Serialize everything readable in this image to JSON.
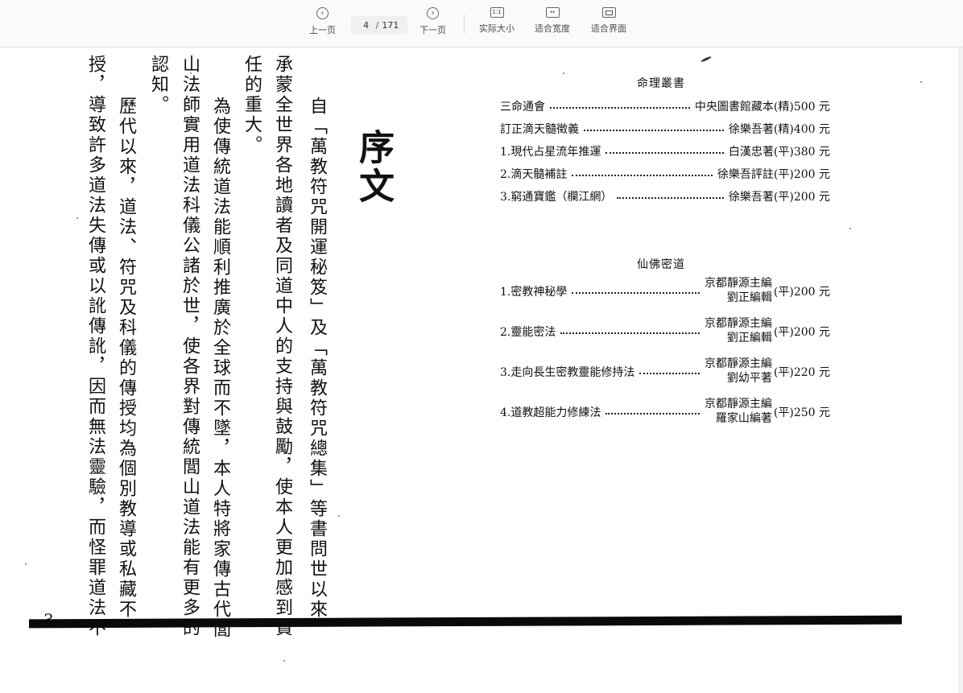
{
  "toolbar": {
    "prev_label": "上一页",
    "current_page": "4",
    "page_separator": "/",
    "total_pages": "171",
    "next_label": "下一页",
    "actual_size_label": "实际大小",
    "fit_width_label": "适合宽度",
    "fit_page_label": "适合界面",
    "actual_size_icon_text": "1:1",
    "fit_width_icon_text": "↔"
  },
  "left_page": {
    "title": "序文",
    "columns": [
      "自「萬教符咒開運秘笈」及「萬教符咒總集」等書問世以來，",
      "承蒙全世界各地讀者及同道中人的支持與鼓勵，使本人更加感到責",
      "任的重大。",
      "為使傳統道法能順利推廣於全球而不墜，本人特將家傳古代閭",
      "山法師實用道法科儀公諸於世，使各界對傳統閭山道法能有更多的",
      "認知。",
      "歷代以來，道法、符咒及科儀的傳授均為個別教導或私藏不",
      "授，導致許多道法失傳或以訛傳訛，因而無法靈驗，而怪罪道法不"
    ],
    "page_number": "3"
  },
  "right_page": {
    "section1_title": "命理叢書",
    "section1_books": [
      {
        "title": "三命通會",
        "author": "中央圖書館藏本(精)",
        "price": "500 元"
      },
      {
        "title": "訂正滴天髓徵義",
        "author": "徐樂吾著(精)",
        "price": "400 元"
      },
      {
        "title": "1.現代占星流年推運",
        "author": "白漢忠著(平)",
        "price": "380 元"
      },
      {
        "title": "2.滴天髓補註",
        "author": "徐樂吾評註(平)",
        "price": "200 元"
      },
      {
        "title": "3.窮通寶鑑（欄江網）",
        "author": "徐樂吾著(平)",
        "price": "200 元"
      }
    ],
    "section2_title": "仙佛密道",
    "section2_books": [
      {
        "title": "1.密教神秘學",
        "author_line1": "京都靜源主編",
        "author_line2": "劉正編輯",
        "binding": "(平)",
        "price": "200 元"
      },
      {
        "title": "2.靈能密法",
        "author_line1": "京都靜源主編",
        "author_line2": "劉正編輯",
        "binding": "(平)",
        "price": "200 元"
      },
      {
        "title": "3.走向長生密教靈能修持法",
        "author_line1": "京都靜源主編",
        "author_line2": "劉幼平著",
        "binding": "(平)",
        "price": "220 元"
      },
      {
        "title": "4.道教超能力修練法",
        "author_line1": "京都靜源主編",
        "author_line2": "羅家山編著",
        "binding": "(平)",
        "price": "250 元"
      }
    ]
  }
}
